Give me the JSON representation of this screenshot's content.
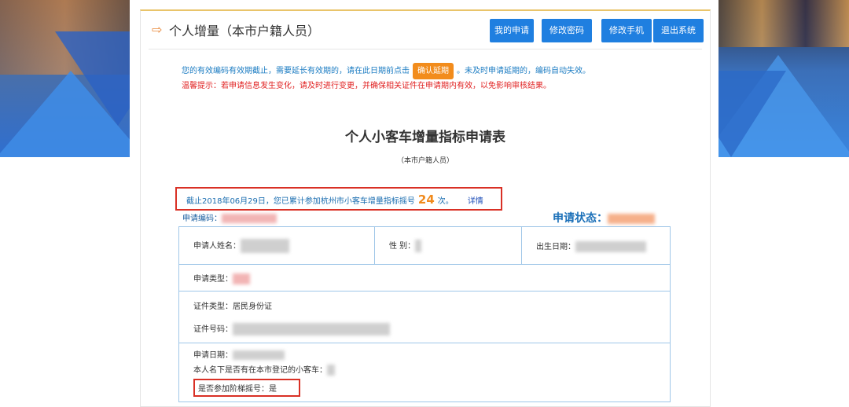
{
  "header": {
    "title": "个人增量（本市户籍人员）",
    "buttons": [
      "我的申请",
      "修改密码",
      "修改手机",
      "退出系统"
    ]
  },
  "notice": {
    "line1_before": "您的有效编码有效期截止，需要延长有效期的，请在此日期前点击",
    "confirm_label": "确认延期",
    "line1_after": "。未及时申请延期的，编码自动失效。",
    "warning": "温馨提示：若申请信息发生变化，请及时进行变更，并确保相关证件在申请期内有效，以免影响审核结果。"
  },
  "form": {
    "title": "个人小客车增量指标申请表",
    "subtitle": "（本市户籍人员）",
    "lottery_prefix": "截止2018年06月29日，您已累计参加杭州市小客车增量指标摇号",
    "lottery_count": "24",
    "lottery_suffix": "次。",
    "detail_link": "详情",
    "app_no_label": "申请编码：",
    "status_label": "申请状态：",
    "fields": {
      "name": "申请人姓名：",
      "gender": "性 别：",
      "birth": "出生日期：",
      "apply_type": "申请类型：",
      "id_type_label": "证件类型：",
      "id_type_value": "居民身份证",
      "id_no": "证件号码：",
      "apply_date": "申请日期：",
      "has_car": "本人名下是否有在本市登记的小客车：",
      "step_lottery_label": "是否参加阶梯摇号：",
      "step_lottery_value": "是"
    }
  },
  "colors": {
    "accent": "#1f7fe0",
    "orange": "#f28c1c",
    "warning": "#e02020",
    "highlight_border": "#d93025"
  }
}
